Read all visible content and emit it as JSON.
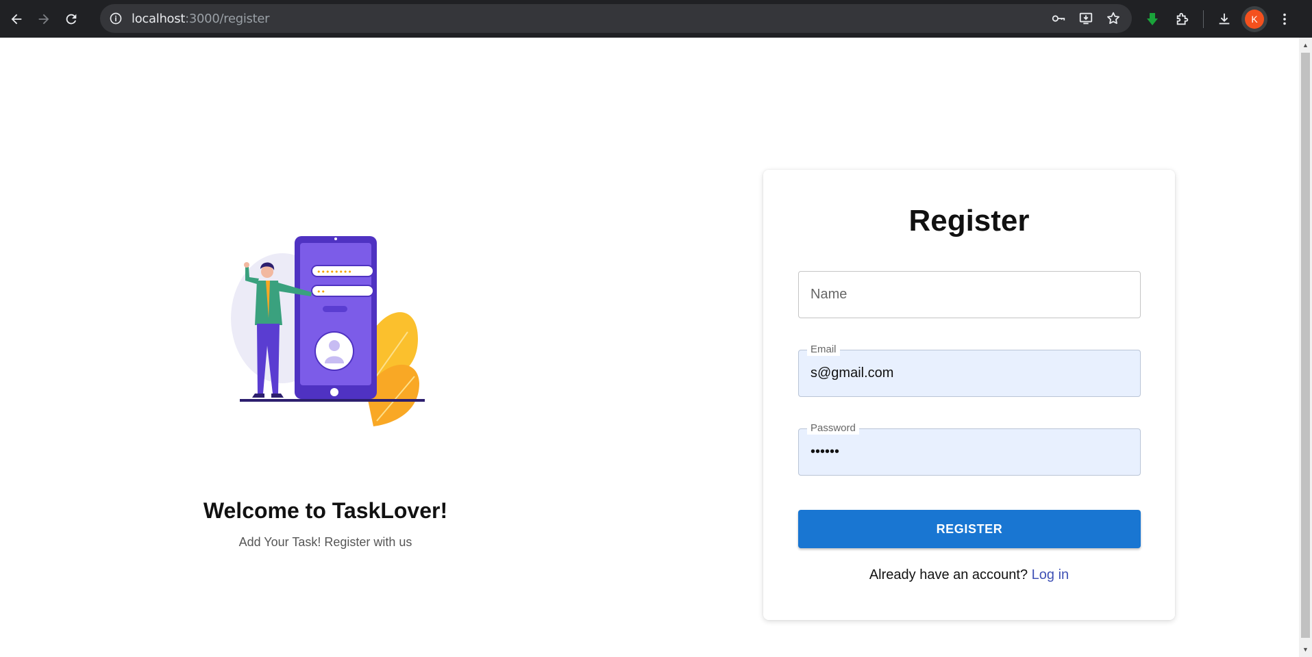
{
  "browser": {
    "url_host": "localhost",
    "url_path": ":3000/register",
    "profile_initial": "K",
    "icons": {
      "back": "arrow-left-icon",
      "forward": "arrow-right-icon",
      "reload": "reload-icon",
      "site_info": "info-icon",
      "password": "key-icon",
      "install": "install-app-icon",
      "bookmark": "star-icon",
      "extension_download": "green-down-arrow-icon",
      "extensions": "puzzle-icon",
      "downloads": "download-icon",
      "menu": "kebab-menu-icon"
    },
    "colors": {
      "chrome_bg": "#202124",
      "omnibox_bg": "#35363a",
      "avatar_bg": "#f4511e"
    }
  },
  "welcome": {
    "title": "Welcome to TaskLover!",
    "subtitle": "Add Your Task! Register with us"
  },
  "form": {
    "title": "Register",
    "name": {
      "placeholder": "Name",
      "value": ""
    },
    "email": {
      "label": "Email",
      "value": "s@gmail.com"
    },
    "password": {
      "label": "Password",
      "value": "••••••"
    },
    "submit_label": "REGISTER",
    "login_prompt": "Already have an account?",
    "login_link": "Log in",
    "colors": {
      "primary": "#1976d2",
      "link": "#3f51b5",
      "autofill_bg": "#e8f0fe"
    }
  }
}
